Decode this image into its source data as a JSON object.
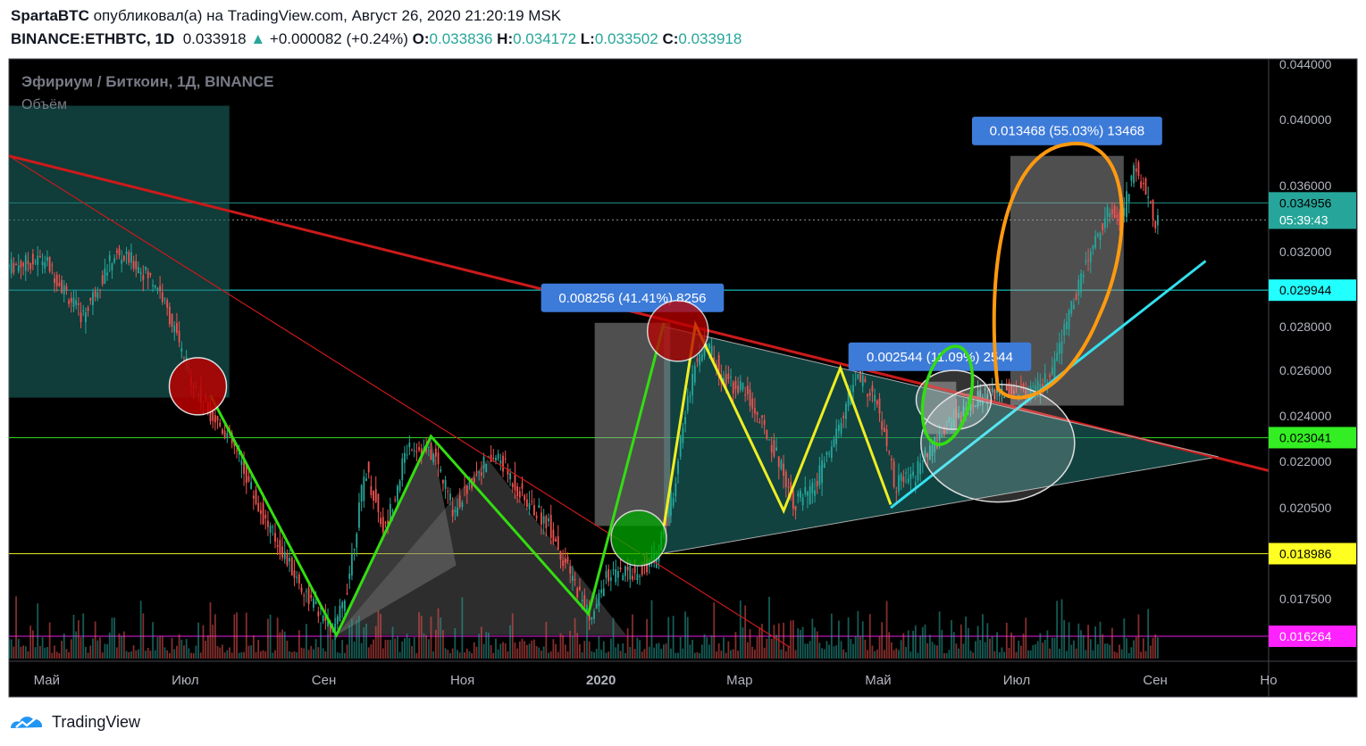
{
  "header": {
    "author": "SpartaBTC",
    "published_text": "опубликовал(а) на TradingView.com, Август 26, 2020 21:20:19 MSK",
    "symbol": "BINANCE:ETHBTC, 1D",
    "last": "0.033918",
    "change": "+0.000082 (+0.24%)",
    "o_label": "O:",
    "o": "0.033836",
    "h_label": "H:",
    "h": "0.034172",
    "l_label": "L:",
    "l": "0.033502",
    "c_label": "C:",
    "c": "0.033918"
  },
  "legend": {
    "title": "Эфириум / Биткоин, 1Д, BINANCE",
    "volume": "Объём"
  },
  "footer": {
    "brand": "TradingView"
  },
  "colors": {
    "background": "#000000",
    "up": "#26a69a",
    "down": "#ef5350",
    "trend_red": "#cc1a1a",
    "zigzag_green": "#33dd11",
    "zigzag_yellow": "#eeee22",
    "trend_cyan": "#33e0ee",
    "highlight_orange": "#ff9a10",
    "measure_blue": "#3d7bd9"
  },
  "chart_data": {
    "type": "candlestick",
    "symbol": "ETHBTC",
    "interval": "1D",
    "ylim": [
      0.0159,
      0.0443
    ],
    "y_ticks": [
      "0.044000",
      "0.040000",
      "0.036000",
      "0.032000",
      "0.028000",
      "0.026000",
      "0.024000",
      "0.022000",
      "0.020500",
      "0.017500"
    ],
    "x_ticks": [
      "Май",
      "Июл",
      "Сен",
      "Ноя",
      "2020",
      "Мар",
      "Май",
      "Июл",
      "Сен",
      "Но"
    ],
    "x_tick_t": [
      0.03,
      0.14,
      0.25,
      0.36,
      0.47,
      0.58,
      0.69,
      0.8,
      0.91,
      1.0
    ],
    "price_track": [
      [
        0.0,
        0.0312
      ],
      [
        0.03,
        0.0316
      ],
      [
        0.06,
        0.0285
      ],
      [
        0.085,
        0.0318
      ],
      [
        0.1,
        0.0315
      ],
      [
        0.12,
        0.0302
      ],
      [
        0.14,
        0.0266
      ],
      [
        0.155,
        0.0246
      ],
      [
        0.175,
        0.0232
      ],
      [
        0.2,
        0.0205
      ],
      [
        0.235,
        0.0178
      ],
      [
        0.26,
        0.0164
      ],
      [
        0.27,
        0.0178
      ],
      [
        0.285,
        0.0218
      ],
      [
        0.3,
        0.0197
      ],
      [
        0.32,
        0.0228
      ],
      [
        0.34,
        0.0222
      ],
      [
        0.355,
        0.0204
      ],
      [
        0.375,
        0.0218
      ],
      [
        0.39,
        0.0222
      ],
      [
        0.41,
        0.0208
      ],
      [
        0.43,
        0.02
      ],
      [
        0.445,
        0.0185
      ],
      [
        0.465,
        0.0168
      ],
      [
        0.475,
        0.0182
      ],
      [
        0.5,
        0.0184
      ],
      [
        0.515,
        0.0188
      ],
      [
        0.53,
        0.0212
      ],
      [
        0.545,
        0.026
      ],
      [
        0.555,
        0.0274
      ],
      [
        0.57,
        0.0255
      ],
      [
        0.585,
        0.0252
      ],
      [
        0.605,
        0.023
      ],
      [
        0.625,
        0.0207
      ],
      [
        0.64,
        0.021
      ],
      [
        0.655,
        0.0226
      ],
      [
        0.675,
        0.0258
      ],
      [
        0.69,
        0.0247
      ],
      [
        0.705,
        0.0212
      ],
      [
        0.72,
        0.0215
      ],
      [
        0.74,
        0.023
      ],
      [
        0.755,
        0.0242
      ],
      [
        0.77,
        0.0248
      ],
      [
        0.785,
        0.025
      ],
      [
        0.8,
        0.0252
      ],
      [
        0.815,
        0.025
      ],
      [
        0.83,
        0.0258
      ],
      [
        0.845,
        0.029
      ],
      [
        0.86,
        0.032
      ],
      [
        0.875,
        0.0346
      ],
      [
        0.885,
        0.0338
      ],
      [
        0.895,
        0.0372
      ],
      [
        0.905,
        0.0355
      ],
      [
        0.912,
        0.0339
      ]
    ],
    "horizontal_levels": [
      {
        "value": 0.034956,
        "label": "0.034956",
        "color": "#26a69a",
        "text": "#000000"
      },
      {
        "value": 0.029944,
        "label": "0.029944",
        "color": "#22ffff",
        "text": "#000000"
      },
      {
        "value": 0.023041,
        "label": "0.023041",
        "color": "#33ee22",
        "text": "#000000"
      },
      {
        "value": 0.018986,
        "label": "0.018986",
        "color": "#ffff22",
        "text": "#000000"
      },
      {
        "value": 0.016264,
        "label": "0.016264",
        "color": "#ff22ff",
        "text": "#ffffff"
      }
    ],
    "last_price": {
      "value": 0.033918,
      "label": "0.033918"
    },
    "countdown": "05:39:43",
    "measurements": [
      {
        "label": "0.013468 (55.03%) 13468",
        "t0": 0.795,
        "t1": 0.885,
        "y0": 0.02445,
        "y1": 0.0378
      },
      {
        "label": "0.008256 (41.41%) 8256",
        "t0": 0.465,
        "t1": 0.525,
        "y0": 0.0199,
        "y1": 0.0282
      },
      {
        "label": "0.002544 (11.09%) 2544",
        "t0": 0.726,
        "t1": 0.752,
        "y0": 0.0232,
        "y1": 0.0255
      }
    ],
    "trendlines": {
      "main_red": [
        [
          0.0,
          0.0378
        ],
        [
          1.0,
          0.0217
        ]
      ],
      "thin_red": [
        [
          0.0,
          0.0378
        ],
        [
          0.62,
          0.0159
        ]
      ],
      "cyan": [
        [
          0.7,
          0.0205
        ],
        [
          0.95,
          0.0315
        ]
      ],
      "triangle_lower": [
        [
          0.52,
          0.019
        ],
        [
          0.96,
          0.0222
        ]
      ],
      "triangle_upper": [
        [
          0.52,
          0.028
        ],
        [
          0.96,
          0.0222
        ]
      ]
    },
    "zigzag_green": [
      [
        0.16,
        0.0249
      ],
      [
        0.26,
        0.0163
      ],
      [
        0.335,
        0.0231
      ],
      [
        0.46,
        0.017
      ],
      [
        0.52,
        0.0282
      ]
    ],
    "zigzag_yellow": [
      [
        0.52,
        0.0199
      ],
      [
        0.545,
        0.0281
      ],
      [
        0.615,
        0.0204
      ],
      [
        0.66,
        0.0261
      ],
      [
        0.7,
        0.0206
      ]
    ]
  }
}
